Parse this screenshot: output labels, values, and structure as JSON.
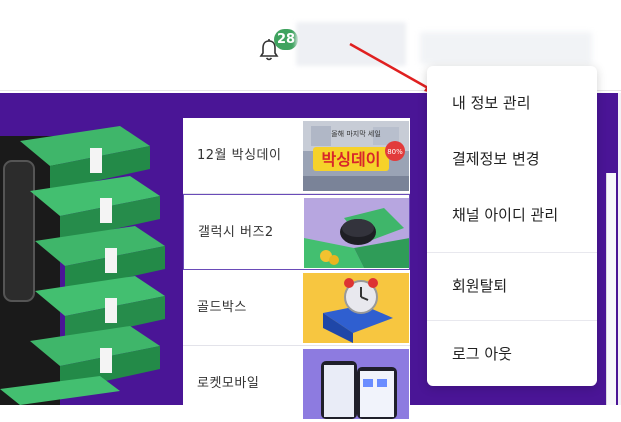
{
  "header": {
    "notification_count": "28",
    "bell_icon": "bell-icon"
  },
  "promos": [
    {
      "label": "12월 박싱데이",
      "thumb_title": "박싱데이",
      "thumb_badge": "80%",
      "thumb_sub": "올해 마지막 세일"
    },
    {
      "label": "갤럭시 버즈2"
    },
    {
      "label": "골드박스"
    },
    {
      "label": "로켓모바일"
    }
  ],
  "menu": {
    "items": [
      {
        "label": "내 정보 관리"
      },
      {
        "label": "결제정보 변경"
      },
      {
        "label": "채널 아이디 관리"
      },
      {
        "label": "회원탈퇴"
      },
      {
        "label": "로그 아웃"
      }
    ]
  },
  "colors": {
    "accent_purple": "#4a1596",
    "badge_green": "#3fa35f",
    "arrow_red": "#e02020"
  }
}
